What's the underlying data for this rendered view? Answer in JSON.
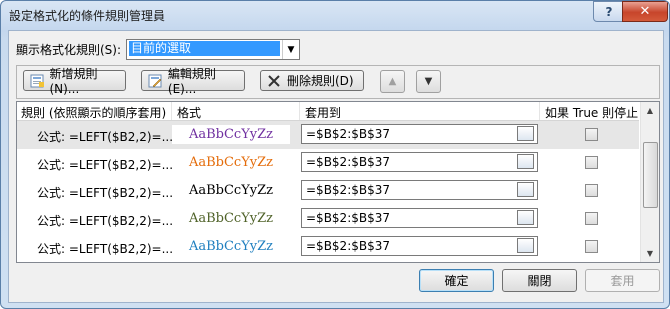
{
  "window": {
    "title": "設定格式化的條件規則管理員",
    "help_label": "?",
    "close_label": "✕"
  },
  "scope": {
    "label": "顯示格式化規則(S):",
    "selected": "目前的選取"
  },
  "toolbar": {
    "new_label": "新增規則(N)...",
    "edit_label": "編輯規則(E)...",
    "delete_label": "刪除規則(D)"
  },
  "columns": {
    "rule": "規則 (依照顯示的順序套用)",
    "format": "格式",
    "applies_to": "套用到",
    "stop_if_true": "如果 True 則停止"
  },
  "rules": [
    {
      "rule": "公式: =LEFT($B2,2)=...",
      "preview": "AaBbCcYyZz",
      "color": "#7030a0",
      "applies_to": "=$B$2:$B$37",
      "stop": false
    },
    {
      "rule": "公式: =LEFT($B2,2)=...",
      "preview": "AaBbCcYyZz",
      "color": "#e46c0a",
      "applies_to": "=$B$2:$B$37",
      "stop": false
    },
    {
      "rule": "公式: =LEFT($B2,2)=...",
      "preview": "AaBbCcYyZz",
      "color": "#000000",
      "applies_to": "=$B$2:$B$37",
      "stop": false
    },
    {
      "rule": "公式: =LEFT($B2,2)=...",
      "preview": "AaBbCcYyZz",
      "color": "#4f6228",
      "applies_to": "=$B$2:$B$37",
      "stop": false
    },
    {
      "rule": "公式: =LEFT($B2,2)=...",
      "preview": "AaBbCcYyZz",
      "color": "#1f7fbf",
      "applies_to": "=$B$2:$B$37",
      "stop": false
    }
  ],
  "footer": {
    "ok_label": "確定",
    "close_label": "關閉",
    "apply_label": "套用"
  }
}
